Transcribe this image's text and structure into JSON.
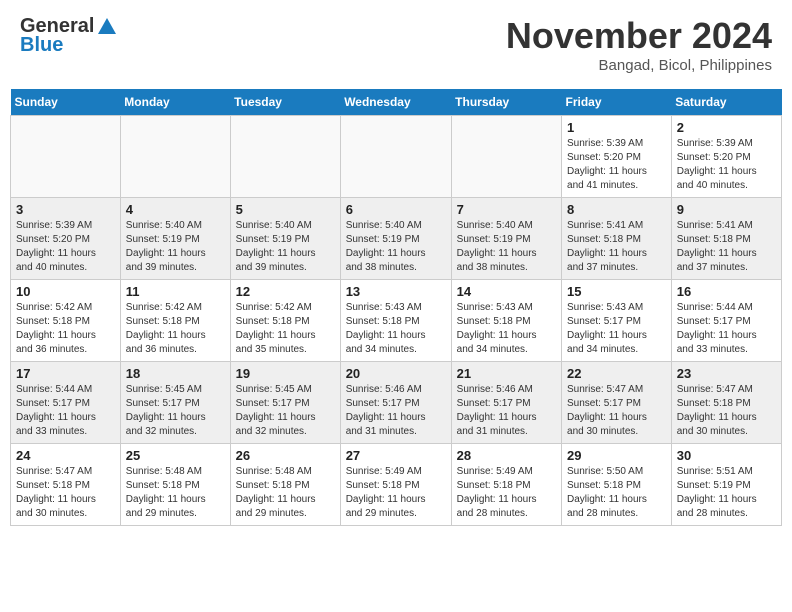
{
  "header": {
    "logo_general": "General",
    "logo_blue": "Blue",
    "month_title": "November 2024",
    "location": "Bangad, Bicol, Philippines"
  },
  "weekdays": [
    "Sunday",
    "Monday",
    "Tuesday",
    "Wednesday",
    "Thursday",
    "Friday",
    "Saturday"
  ],
  "rows": [
    {
      "shade": false,
      "cells": [
        {
          "day": "",
          "info": ""
        },
        {
          "day": "",
          "info": ""
        },
        {
          "day": "",
          "info": ""
        },
        {
          "day": "",
          "info": ""
        },
        {
          "day": "",
          "info": ""
        },
        {
          "day": "1",
          "info": "Sunrise: 5:39 AM\nSunset: 5:20 PM\nDaylight: 11 hours\nand 41 minutes."
        },
        {
          "day": "2",
          "info": "Sunrise: 5:39 AM\nSunset: 5:20 PM\nDaylight: 11 hours\nand 40 minutes."
        }
      ]
    },
    {
      "shade": true,
      "cells": [
        {
          "day": "3",
          "info": "Sunrise: 5:39 AM\nSunset: 5:20 PM\nDaylight: 11 hours\nand 40 minutes."
        },
        {
          "day": "4",
          "info": "Sunrise: 5:40 AM\nSunset: 5:19 PM\nDaylight: 11 hours\nand 39 minutes."
        },
        {
          "day": "5",
          "info": "Sunrise: 5:40 AM\nSunset: 5:19 PM\nDaylight: 11 hours\nand 39 minutes."
        },
        {
          "day": "6",
          "info": "Sunrise: 5:40 AM\nSunset: 5:19 PM\nDaylight: 11 hours\nand 38 minutes."
        },
        {
          "day": "7",
          "info": "Sunrise: 5:40 AM\nSunset: 5:19 PM\nDaylight: 11 hours\nand 38 minutes."
        },
        {
          "day": "8",
          "info": "Sunrise: 5:41 AM\nSunset: 5:18 PM\nDaylight: 11 hours\nand 37 minutes."
        },
        {
          "day": "9",
          "info": "Sunrise: 5:41 AM\nSunset: 5:18 PM\nDaylight: 11 hours\nand 37 minutes."
        }
      ]
    },
    {
      "shade": false,
      "cells": [
        {
          "day": "10",
          "info": "Sunrise: 5:42 AM\nSunset: 5:18 PM\nDaylight: 11 hours\nand 36 minutes."
        },
        {
          "day": "11",
          "info": "Sunrise: 5:42 AM\nSunset: 5:18 PM\nDaylight: 11 hours\nand 36 minutes."
        },
        {
          "day": "12",
          "info": "Sunrise: 5:42 AM\nSunset: 5:18 PM\nDaylight: 11 hours\nand 35 minutes."
        },
        {
          "day": "13",
          "info": "Sunrise: 5:43 AM\nSunset: 5:18 PM\nDaylight: 11 hours\nand 34 minutes."
        },
        {
          "day": "14",
          "info": "Sunrise: 5:43 AM\nSunset: 5:18 PM\nDaylight: 11 hours\nand 34 minutes."
        },
        {
          "day": "15",
          "info": "Sunrise: 5:43 AM\nSunset: 5:17 PM\nDaylight: 11 hours\nand 34 minutes."
        },
        {
          "day": "16",
          "info": "Sunrise: 5:44 AM\nSunset: 5:17 PM\nDaylight: 11 hours\nand 33 minutes."
        }
      ]
    },
    {
      "shade": true,
      "cells": [
        {
          "day": "17",
          "info": "Sunrise: 5:44 AM\nSunset: 5:17 PM\nDaylight: 11 hours\nand 33 minutes."
        },
        {
          "day": "18",
          "info": "Sunrise: 5:45 AM\nSunset: 5:17 PM\nDaylight: 11 hours\nand 32 minutes."
        },
        {
          "day": "19",
          "info": "Sunrise: 5:45 AM\nSunset: 5:17 PM\nDaylight: 11 hours\nand 32 minutes."
        },
        {
          "day": "20",
          "info": "Sunrise: 5:46 AM\nSunset: 5:17 PM\nDaylight: 11 hours\nand 31 minutes."
        },
        {
          "day": "21",
          "info": "Sunrise: 5:46 AM\nSunset: 5:17 PM\nDaylight: 11 hours\nand 31 minutes."
        },
        {
          "day": "22",
          "info": "Sunrise: 5:47 AM\nSunset: 5:17 PM\nDaylight: 11 hours\nand 30 minutes."
        },
        {
          "day": "23",
          "info": "Sunrise: 5:47 AM\nSunset: 5:18 PM\nDaylight: 11 hours\nand 30 minutes."
        }
      ]
    },
    {
      "shade": false,
      "cells": [
        {
          "day": "24",
          "info": "Sunrise: 5:47 AM\nSunset: 5:18 PM\nDaylight: 11 hours\nand 30 minutes."
        },
        {
          "day": "25",
          "info": "Sunrise: 5:48 AM\nSunset: 5:18 PM\nDaylight: 11 hours\nand 29 minutes."
        },
        {
          "day": "26",
          "info": "Sunrise: 5:48 AM\nSunset: 5:18 PM\nDaylight: 11 hours\nand 29 minutes."
        },
        {
          "day": "27",
          "info": "Sunrise: 5:49 AM\nSunset: 5:18 PM\nDaylight: 11 hours\nand 29 minutes."
        },
        {
          "day": "28",
          "info": "Sunrise: 5:49 AM\nSunset: 5:18 PM\nDaylight: 11 hours\nand 28 minutes."
        },
        {
          "day": "29",
          "info": "Sunrise: 5:50 AM\nSunset: 5:18 PM\nDaylight: 11 hours\nand 28 minutes."
        },
        {
          "day": "30",
          "info": "Sunrise: 5:51 AM\nSunset: 5:19 PM\nDaylight: 11 hours\nand 28 minutes."
        }
      ]
    }
  ]
}
